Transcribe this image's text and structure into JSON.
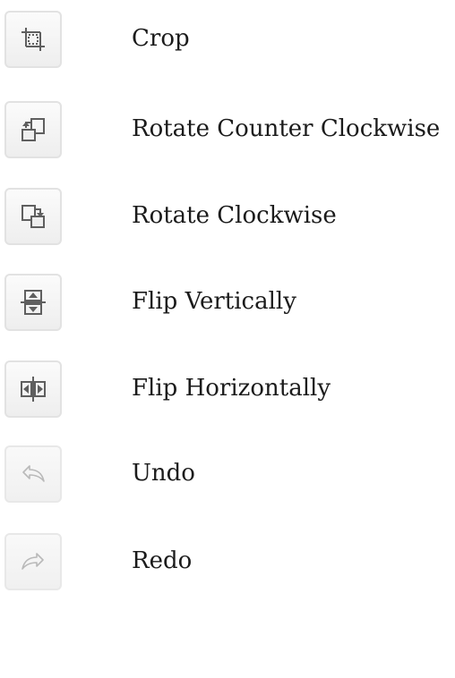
{
  "tools": [
    {
      "label": "Crop",
      "icon": "crop-icon",
      "enabled": true
    },
    {
      "label": "Rotate Counter Clockwise",
      "icon": "rotate-counter-clockwise-icon",
      "enabled": true
    },
    {
      "label": "Rotate Clockwise",
      "icon": "rotate-clockwise-icon",
      "enabled": true
    },
    {
      "label": "Flip Vertically",
      "icon": "flip-vertical-icon",
      "enabled": true
    },
    {
      "label": "Flip Horizontally",
      "icon": "flip-horizontal-icon",
      "enabled": true
    },
    {
      "label": "Undo",
      "icon": "undo-icon",
      "enabled": false
    },
    {
      "label": "Redo",
      "icon": "redo-icon",
      "enabled": false
    }
  ],
  "colors": {
    "icon_stroke": "#5f5f5f",
    "icon_disabled": "#b9b9b9",
    "button_border": "#e2e2e2",
    "text": "#1b1b1b"
  }
}
